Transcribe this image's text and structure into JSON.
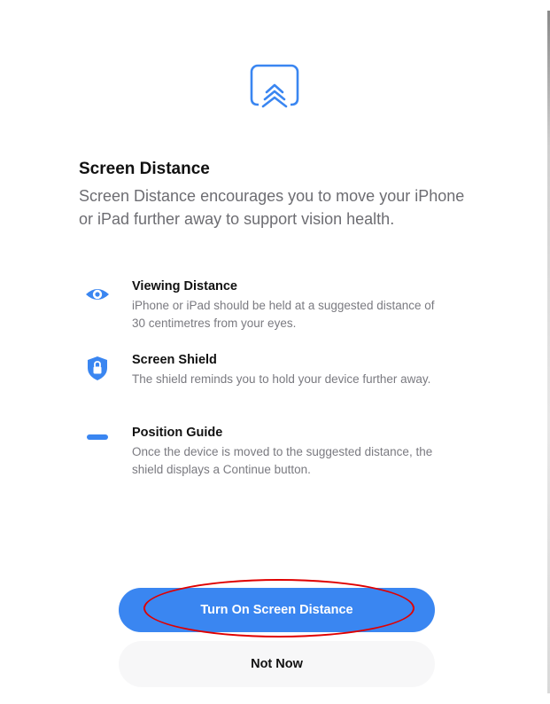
{
  "header": {
    "icon": "screen-distance-icon",
    "title": "Screen Distance",
    "description": "Screen Distance encourages you to move your iPhone or iPad further away to support vision health."
  },
  "features": [
    {
      "icon": "eye-icon",
      "title": "Viewing Distance",
      "text": "iPhone or iPad should be held at a suggested distance of 30 centimetres from your eyes."
    },
    {
      "icon": "shield-lock-icon",
      "title": "Screen Shield",
      "text": "The shield reminds you to hold your device further away."
    },
    {
      "icon": "position-bar-icon",
      "title": "Position Guide",
      "text": "Once the device is moved to the suggested distance, the shield displays a Continue button."
    }
  ],
  "actions": {
    "primary_label": "Turn On Screen Distance",
    "secondary_label": "Not Now"
  },
  "colors": {
    "accent": "#3a86f1",
    "annotation": "#e00000",
    "secondary_text": "#6d6d72"
  }
}
